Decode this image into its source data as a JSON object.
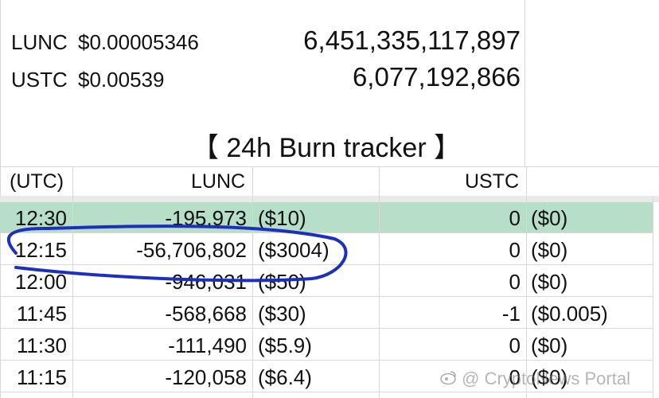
{
  "prices": [
    {
      "ticker": "LUNC",
      "price": "$0.00005346",
      "amount": "6,451,335,117,897"
    },
    {
      "ticker": "USTC",
      "price": "$0.00539",
      "amount": "6,077,192,866"
    }
  ],
  "title": "【 24h Burn tracker 】",
  "headers": {
    "time": "(UTC)",
    "lunc": "LUNC",
    "ustc": "USTC"
  },
  "rows": [
    {
      "time": "12:30",
      "lunc": "-195,973",
      "lunc_usd": "($10)",
      "ustc": "0",
      "ustc_usd": "($0)"
    },
    {
      "time": "12:15",
      "lunc": "-56,706,802",
      "lunc_usd": "($3004)",
      "ustc": "0",
      "ustc_usd": "($0)"
    },
    {
      "time": "12:00",
      "lunc": "-946,031",
      "lunc_usd": "($50)",
      "ustc": "0",
      "ustc_usd": "($0)"
    },
    {
      "time": "11:45",
      "lunc": "-568,668",
      "lunc_usd": "($30)",
      "ustc": "-1",
      "ustc_usd": "($0.005)"
    },
    {
      "time": "11:30",
      "lunc": "-111,490",
      "lunc_usd": "($5.9)",
      "ustc": "0",
      "ustc_usd": "($0)"
    },
    {
      "time": "11:15",
      "lunc": "-120,058",
      "lunc_usd": "($6.4)",
      "ustc": "0",
      "ustc_usd": "($0)"
    }
  ],
  "watermark": "@ CryptoNews Portal",
  "colors": {
    "highlight_row": "#b7dfc8",
    "annotation": "#1d2fbf",
    "grid": "#d8d8d8"
  }
}
